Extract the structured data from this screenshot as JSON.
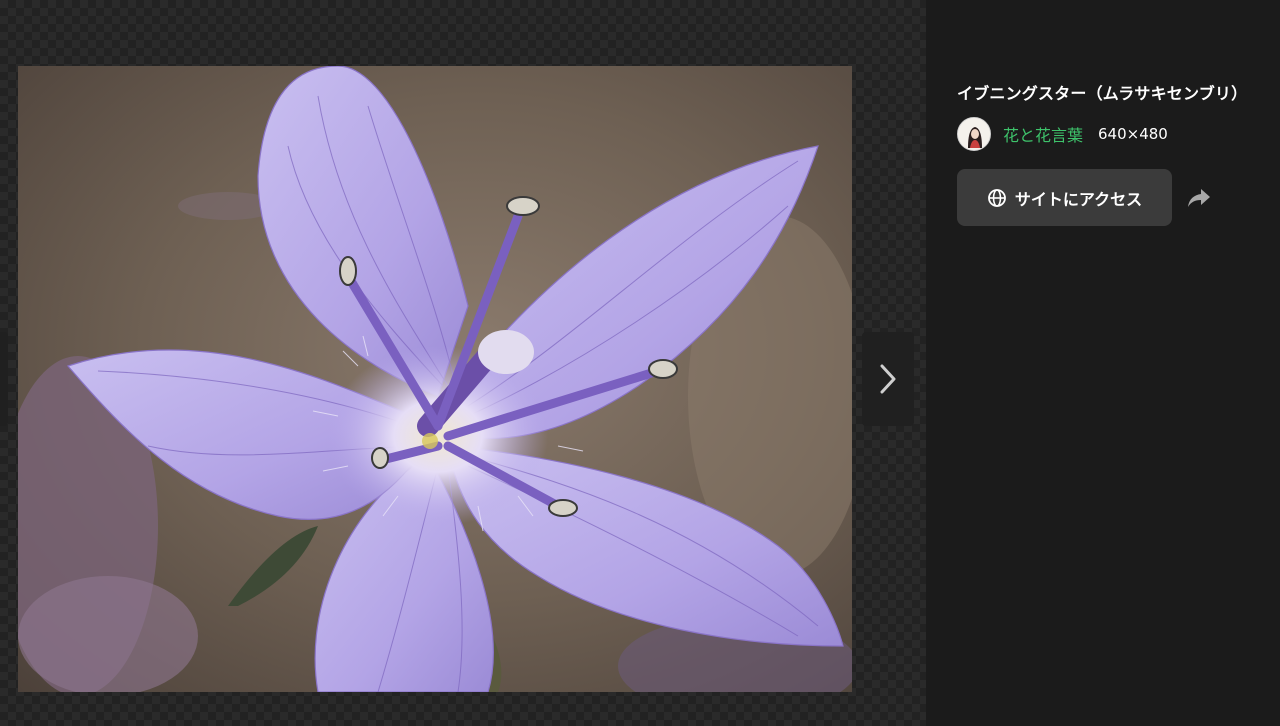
{
  "image": {
    "alt": "イブニングスター（ムラサキセンブリ）"
  },
  "sidebar": {
    "title": "イブニングスター（ムラサキセンブリ）",
    "source_name": "花と花言葉",
    "dimensions": "640×480",
    "access_button_label": "サイトにアクセス",
    "icons": {
      "globe": "globe-icon",
      "share": "share-icon",
      "next": "chevron-right-icon"
    }
  },
  "colors": {
    "background": "#1b1b1b",
    "source_link": "#3ec36b",
    "button_bg": "#3b3b3b",
    "petal": "#b8a9ea"
  }
}
